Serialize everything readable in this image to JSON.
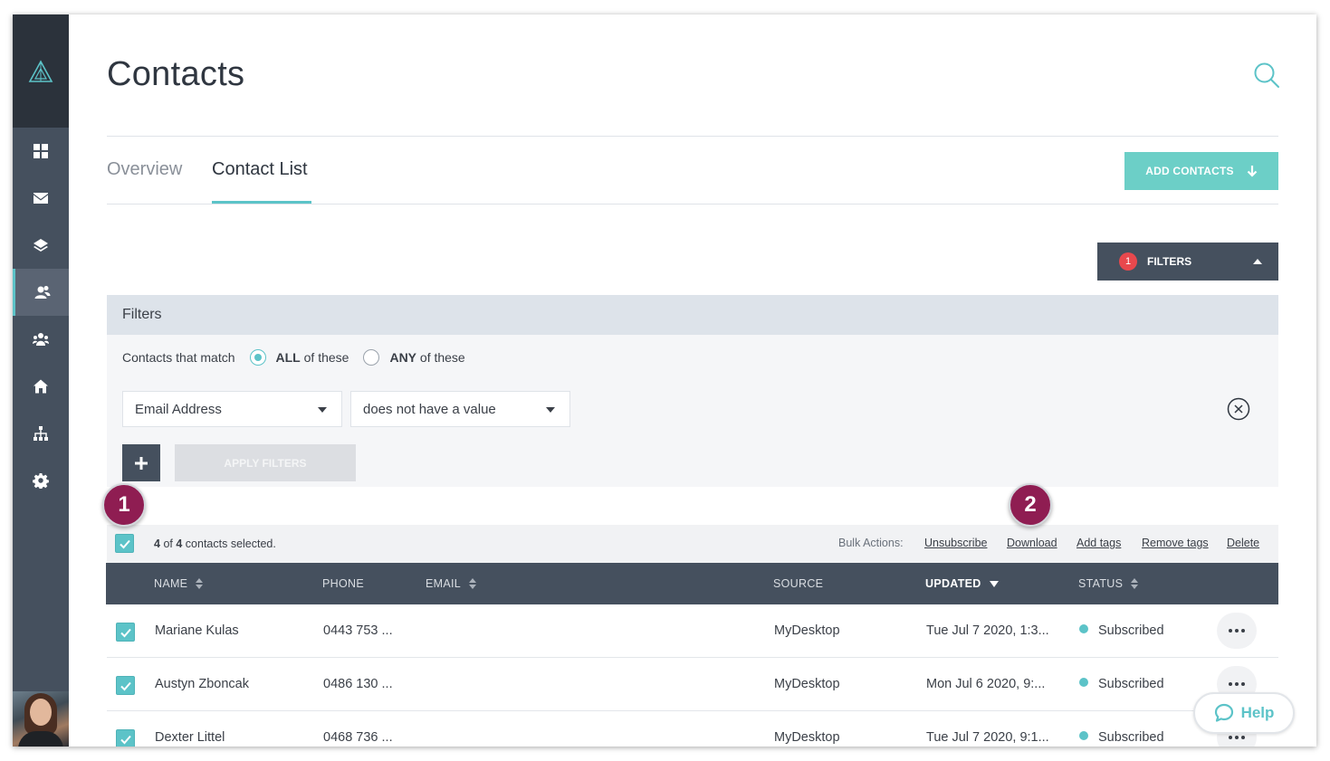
{
  "page": {
    "title": "Contacts"
  },
  "sidebar": {
    "items": [
      {
        "icon": "dashboard-icon"
      },
      {
        "icon": "mail-icon"
      },
      {
        "icon": "layers-icon"
      },
      {
        "icon": "contacts-icon",
        "active": true
      },
      {
        "icon": "team-icon"
      },
      {
        "icon": "home-icon"
      },
      {
        "icon": "hierarchy-icon"
      },
      {
        "icon": "gear-icon"
      }
    ]
  },
  "tabs": [
    {
      "label": "Overview",
      "active": false
    },
    {
      "label": "Contact List",
      "active": true
    }
  ],
  "add_contacts_label": "ADD CONTACTS",
  "filters_button": {
    "label": "FILTERS",
    "count": "1"
  },
  "filters_panel": {
    "heading": "Filters",
    "match_label": "Contacts that match",
    "all_strong": "ALL",
    "all_rest": "of these",
    "any_strong": "ANY",
    "any_rest": "of these",
    "selected_match": "ALL",
    "field_value": "Email Address",
    "condition_value": "does not have a value",
    "apply_label": "APPLY FILTERS"
  },
  "markers": {
    "first": "1",
    "second": "2"
  },
  "selection": {
    "count": "4",
    "of_word": "of",
    "total": "4",
    "suffix": "contacts selected.",
    "bulk_label": "Bulk Actions:",
    "actions": [
      "Unsubscribe",
      "Download",
      "Add tags",
      "Remove tags",
      "Delete"
    ]
  },
  "table": {
    "columns": {
      "name": "NAME",
      "phone": "PHONE",
      "email": "EMAIL",
      "source": "SOURCE",
      "updated": "UPDATED",
      "status": "STATUS"
    },
    "rows": [
      {
        "name": "Mariane Kulas",
        "phone": "0443 753 ...",
        "source": "MyDesktop",
        "updated": "Tue Jul 7 2020, 1:3...",
        "status": "Subscribed",
        "checked": true
      },
      {
        "name": "Austyn Zboncak",
        "phone": "0486 130 ...",
        "source": "MyDesktop",
        "updated": "Mon Jul 6 2020, 9:...",
        "status": "Subscribed",
        "checked": true
      },
      {
        "name": "Dexter Littel",
        "phone": "0468 736 ...",
        "source": "MyDesktop",
        "updated": "Tue Jul 7 2020, 9:1...",
        "status": "Subscribed",
        "checked": true
      }
    ]
  },
  "help_label": "Help",
  "colors": {
    "accent": "#5cc3c8",
    "sidebar": "#45505e",
    "badge": "#e8484d",
    "marker": "#8f1d52"
  }
}
